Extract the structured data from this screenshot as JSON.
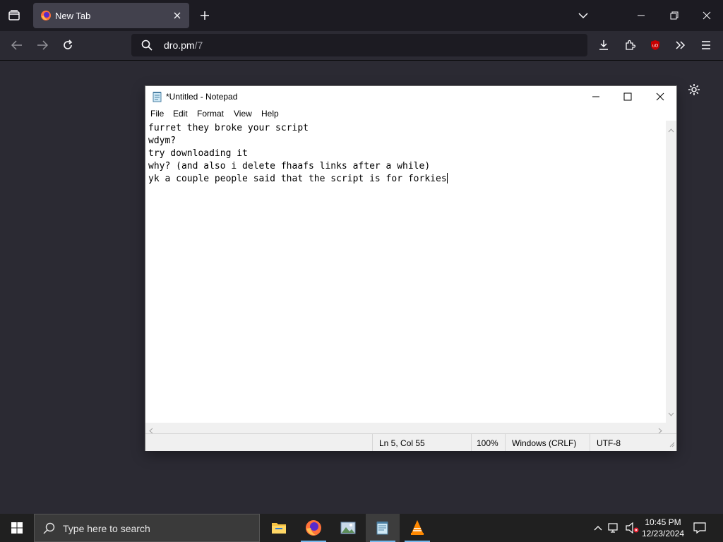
{
  "browser": {
    "tab_title": "New Tab",
    "url_domain": "dro.pm",
    "url_path": "/7"
  },
  "notepad": {
    "title": "*Untitled - Notepad",
    "menu": [
      "File",
      "Edit",
      "Format",
      "View",
      "Help"
    ],
    "lines": [
      "furret they broke your script",
      "wdym?",
      "try downloading it",
      "why? (and also i delete fhaafs links after a while)",
      "yk a couple people said that the script is for forkies"
    ],
    "status": {
      "position": "Ln 5, Col 55",
      "zoom": "100%",
      "line_ending": "Windows (CRLF)",
      "encoding": "UTF-8"
    }
  },
  "taskbar": {
    "search_placeholder": "Type here to search",
    "time": "10:45 PM",
    "date": "12/23/2024",
    "apps": [
      "file-explorer-icon",
      "firefox-icon",
      "image-viewer-icon",
      "notepad-icon",
      "vlc-icon"
    ]
  },
  "colors": {
    "firefox_bg": "#2b2a33",
    "tabbar_bg": "#1c1b22",
    "taskbar_bg": "#202020",
    "taskbar_accent": "#76b9ed"
  }
}
